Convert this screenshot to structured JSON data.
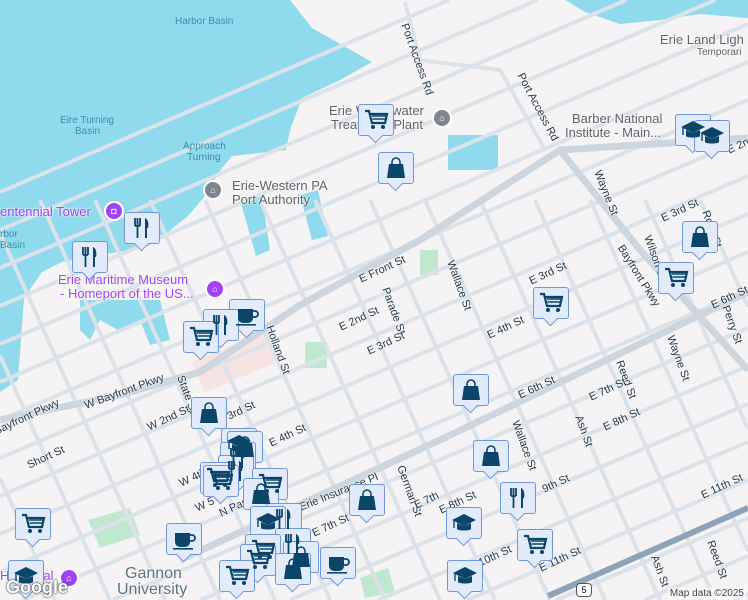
{
  "colors": {
    "water": "#90daee",
    "land": "#f5f3f3",
    "road": "#dbe2ea",
    "marker_fill": "#e2ebfb",
    "marker_border": "#7097da",
    "marker_icon": "#0b466a",
    "poi_purple": "#a142f4"
  },
  "water_labels": {
    "harbor_basin": "Harbor Basin",
    "turning_basin_1": "Eire Turning",
    "turning_basin_2": "Basin",
    "approach_1": "Approach",
    "approach_2": "Turning",
    "harbor_frag_1": "rbor",
    "harbor_frag_2": "Basin"
  },
  "pois": {
    "port_authority_1": "Erie-Western PA",
    "port_authority_2": "Port Authority",
    "centennial": "entennial Tower",
    "maritime_1": "Erie Maritime Museum",
    "maritime_2": "- Homeport of the US...",
    "water_plant_1": "Erie Wastewater",
    "water_plant_2": "Treatment Plant",
    "land_light_1": "Erie Land Ligh",
    "land_light_2": "Temporari",
    "barber_1": "Barber National",
    "barber_2": "Institute - Main...",
    "gannon_1": "Gannon",
    "gannon_2": "University",
    "historical": "Historical"
  },
  "streets": [
    "Port Access Rd",
    "Port Access Rd",
    "Wayne St",
    "E 3rd St",
    "Ross St",
    "Wilson St",
    "Bayfront Pkwy",
    "E 2nd St",
    "E Front St",
    "Parade St",
    "Wallace St",
    "E 3rd St",
    "E 2nd St",
    "E 3rd St",
    "E 4th St",
    "E 6th St",
    "E 6th St",
    "Perry St",
    "Wayne St",
    "Reed St",
    "E 7th St",
    "Ash St",
    "E 8th St",
    "Wallace St",
    "German St",
    "E 8th St",
    "9th St",
    "E 10th St",
    "E 11th St",
    "E 11th St",
    "Reed St",
    "Ash St",
    "Erie Insurance Pl",
    "E 7th St",
    "Holland St",
    "State St",
    "W Bayfront Pkwy",
    "Bayfront Pkwy",
    "W 2nd St",
    "3rd St",
    "E 4th St",
    "Short St",
    "W 4th",
    "N Park",
    "E 7th",
    "W 5"
  ],
  "route_shield": "5",
  "attribution": "Map data ©2025",
  "google_logo": "Google"
}
